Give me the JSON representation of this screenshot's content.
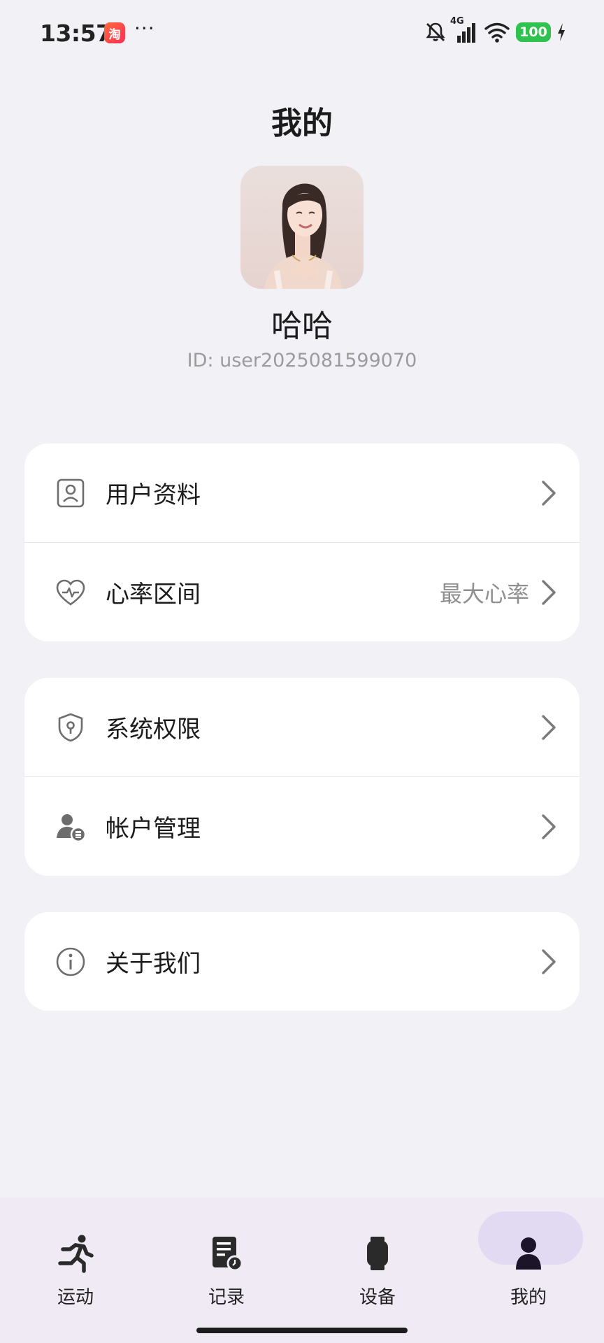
{
  "status_bar": {
    "time": "13:57",
    "app_badge": "淘",
    "more": "···",
    "network": "4G",
    "battery": "100"
  },
  "header": {
    "title": "我的",
    "username": "哈哈",
    "user_id": "ID: user2025081599070"
  },
  "menu": {
    "group1": [
      {
        "label": "用户资料",
        "icon": "user-profile-icon",
        "value": ""
      },
      {
        "label": "心率区间",
        "icon": "heart-rate-icon",
        "value": "最大心率"
      }
    ],
    "group2": [
      {
        "label": "系统权限",
        "icon": "shield-icon",
        "value": ""
      },
      {
        "label": "帐户管理",
        "icon": "account-manage-icon",
        "value": ""
      }
    ],
    "group3": [
      {
        "label": "关于我们",
        "icon": "info-icon",
        "value": ""
      }
    ]
  },
  "bottom_nav": {
    "items": [
      {
        "label": "运动",
        "icon": "running-icon",
        "active": false
      },
      {
        "label": "记录",
        "icon": "record-icon",
        "active": false
      },
      {
        "label": "设备",
        "icon": "watch-icon",
        "active": false
      },
      {
        "label": "我的",
        "icon": "person-icon",
        "active": true
      }
    ]
  },
  "colors": {
    "background": "#f2f1f6",
    "card": "#ffffff",
    "nav_bg": "#efeaf4",
    "active_pill": "#e2d9f3",
    "battery": "#2fc24e"
  }
}
